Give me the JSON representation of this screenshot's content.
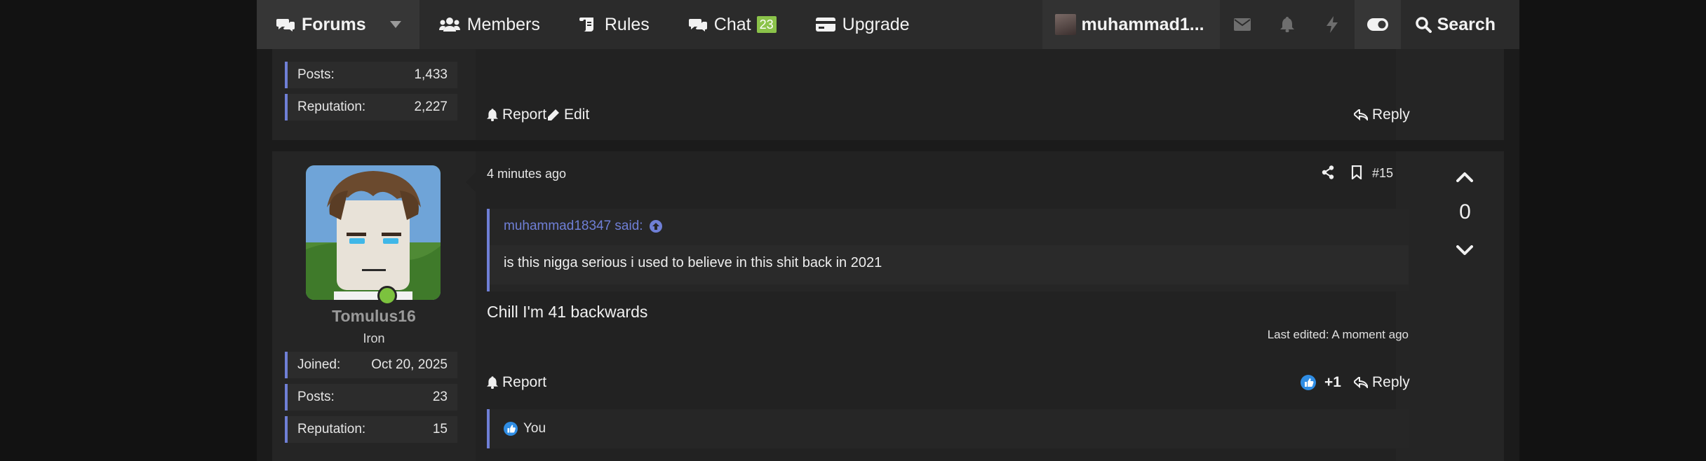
{
  "nav": {
    "forums": "Forums",
    "members": "Members",
    "rules": "Rules",
    "chat": "Chat",
    "chat_badge": "23",
    "upgrade": "Upgrade",
    "username": "muhammad1...",
    "search": "Search"
  },
  "prev_post": {
    "stats": [
      {
        "label": "Posts:",
        "value": "1,433"
      },
      {
        "label": "Reputation:",
        "value": "2,227"
      }
    ],
    "report": "Report",
    "edit": "Edit",
    "reply": "Reply"
  },
  "post": {
    "time": "4 minutes ago",
    "number": "#15",
    "username": "Tomulus16",
    "user_title": "Iron",
    "stats": [
      {
        "label": "Joined:",
        "value": "Oct 20, 2025"
      },
      {
        "label": "Posts:",
        "value": "23"
      },
      {
        "label": "Reputation:",
        "value": "15"
      }
    ],
    "quote_author": "muhammad18347 said:",
    "quote_text": "is this nigga serious i used to believe in this shit back in 2021",
    "body": "Chill I'm 41 backwards",
    "last_edited": "Last edited: A moment ago",
    "report": "Report",
    "reaction_count": "+1",
    "reply": "Reply",
    "reactions_by": "You",
    "vote_score": "0"
  },
  "colors": {
    "accent": "#6f7fd6",
    "badge": "#8bc34a",
    "like_blue": "#2f8de4",
    "online": "#7cc23e"
  }
}
